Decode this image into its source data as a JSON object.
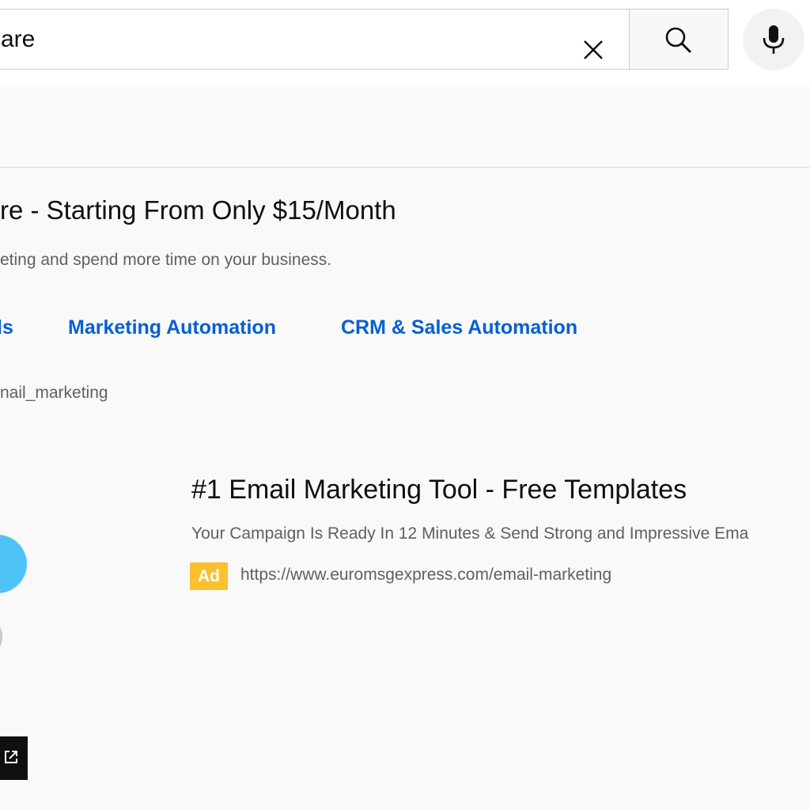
{
  "search": {
    "query": "are",
    "clear_icon": "close-icon",
    "search_icon": "search-icon",
    "mic_icon": "microphone-icon"
  },
  "ad1": {
    "title": "re - Starting From Only $15/Month",
    "description": "eting and spend more time on your business.",
    "sitelinks": [
      "ls",
      "Marketing Automation",
      "CRM & Sales Automation"
    ],
    "url": "nail_marketing"
  },
  "ad2": {
    "title": "#1 Email Marketing Tool - Free Templates",
    "description": "Your Campaign Is Ready In 12 Minutes & Send Strong and Impressive Ema",
    "badge": "Ad",
    "url": "https://www.euromsgexpress.com/email-marketing",
    "external_icon": "external-link-icon"
  },
  "colors": {
    "link": "#065fd4",
    "ad_badge": "#fbc02d",
    "thumbnail_accent": "#4fc3f7"
  }
}
